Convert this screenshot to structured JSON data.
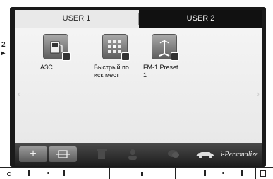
{
  "tabs": [
    {
      "label": "USER 1",
      "active": false
    },
    {
      "label": "USER 2",
      "active": true
    }
  ],
  "items": [
    {
      "name": "app-azs",
      "icon": "fuel-station-icon",
      "label": "АЗС"
    },
    {
      "name": "app-quick-search",
      "icon": "grid-search-icon",
      "label": "Быстрый по\nиск мест"
    },
    {
      "name": "app-fm1-preset",
      "icon": "radio-antenna-icon",
      "label": "FM-1 Preset\n1"
    }
  ],
  "dock": {
    "add_icon": "plus-icon",
    "move_icon": "move-icon",
    "brand_text": "i-Personalize"
  },
  "side_marks": {
    "top": "2",
    "arrow": "▸"
  },
  "colors": {
    "bezel": "#1a1a1a",
    "screen": "#eeeeee",
    "dock": "#333333",
    "active_tab": "#111111"
  }
}
